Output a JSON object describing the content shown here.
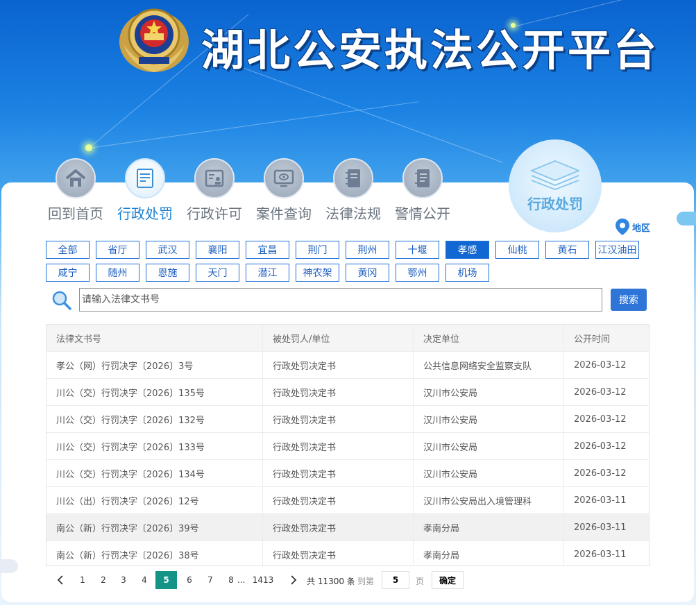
{
  "header": {
    "title": "湖北公安执法公开平台"
  },
  "nav": {
    "items": [
      {
        "label": "回到首页",
        "icon": "home-icon"
      },
      {
        "label": "行政处罚",
        "icon": "document-icon",
        "active": true
      },
      {
        "label": "行政许可",
        "icon": "license-icon"
      },
      {
        "label": "案件查询",
        "icon": "monitor-icon"
      },
      {
        "label": "法律法规",
        "icon": "book-icon"
      },
      {
        "label": "警情公开",
        "icon": "notebook-icon"
      }
    ],
    "current_badge": "行政处罚"
  },
  "region": {
    "label": "地区"
  },
  "regions": {
    "row1": [
      "全部",
      "省厅",
      "武汉",
      "襄阳",
      "宜昌",
      "荆门",
      "荆州",
      "十堰",
      "孝感",
      "仙桃",
      "黄石",
      "江汉油田"
    ],
    "row2": [
      "咸宁",
      "随州",
      "恩施",
      "天门",
      "潜江",
      "神农架",
      "黄冈",
      "鄂州",
      "机场"
    ],
    "selected": "孝感"
  },
  "search": {
    "placeholder": "请输入法律文书号",
    "button": "搜索"
  },
  "table": {
    "headers": [
      "法律文书号",
      "被处罚人/单位",
      "决定单位",
      "公开时间"
    ],
    "rows": [
      [
        "孝公（网）行罚决字〔2026〕3号",
        "行政处罚决定书",
        "公共信息网络安全监察支队",
        "2026-03-12"
      ],
      [
        "川公（交）行罚决字〔2026〕135号",
        "行政处罚决定书",
        "汉川市公安局",
        "2026-03-12"
      ],
      [
        "川公（交）行罚决字〔2026〕132号",
        "行政处罚决定书",
        "汉川市公安局",
        "2026-03-12"
      ],
      [
        "川公（交）行罚决字〔2026〕133号",
        "行政处罚决定书",
        "汉川市公安局",
        "2026-03-12"
      ],
      [
        "川公（交）行罚决字〔2026〕134号",
        "行政处罚决定书",
        "汉川市公安局",
        "2026-03-12"
      ],
      [
        "川公（出）行罚决字〔2026〕12号",
        "行政处罚决定书",
        "汉川市公安局出入境管理科",
        "2026-03-11"
      ],
      [
        "南公（新）行罚决字〔2026〕39号",
        "行政处罚决定书",
        "孝南分局",
        "2026-03-11"
      ],
      [
        "南公（新）行罚决字〔2026〕38号",
        "行政处罚决定书",
        "孝南分局",
        "2026-03-11"
      ]
    ],
    "highlighted_row": 6
  },
  "pagination": {
    "pages": [
      "1",
      "2",
      "3",
      "4",
      "5",
      "6",
      "7",
      "8"
    ],
    "current": "5",
    "ellipsis": "...",
    "last": "1413",
    "total": "共 11300 条",
    "goto_label": "到第",
    "goto_value": "5",
    "page_unit": "页",
    "confirm": "确定"
  },
  "colors": {
    "accent": "#1268d2",
    "active_page": "#139487",
    "search_button": "#2f75d8"
  }
}
